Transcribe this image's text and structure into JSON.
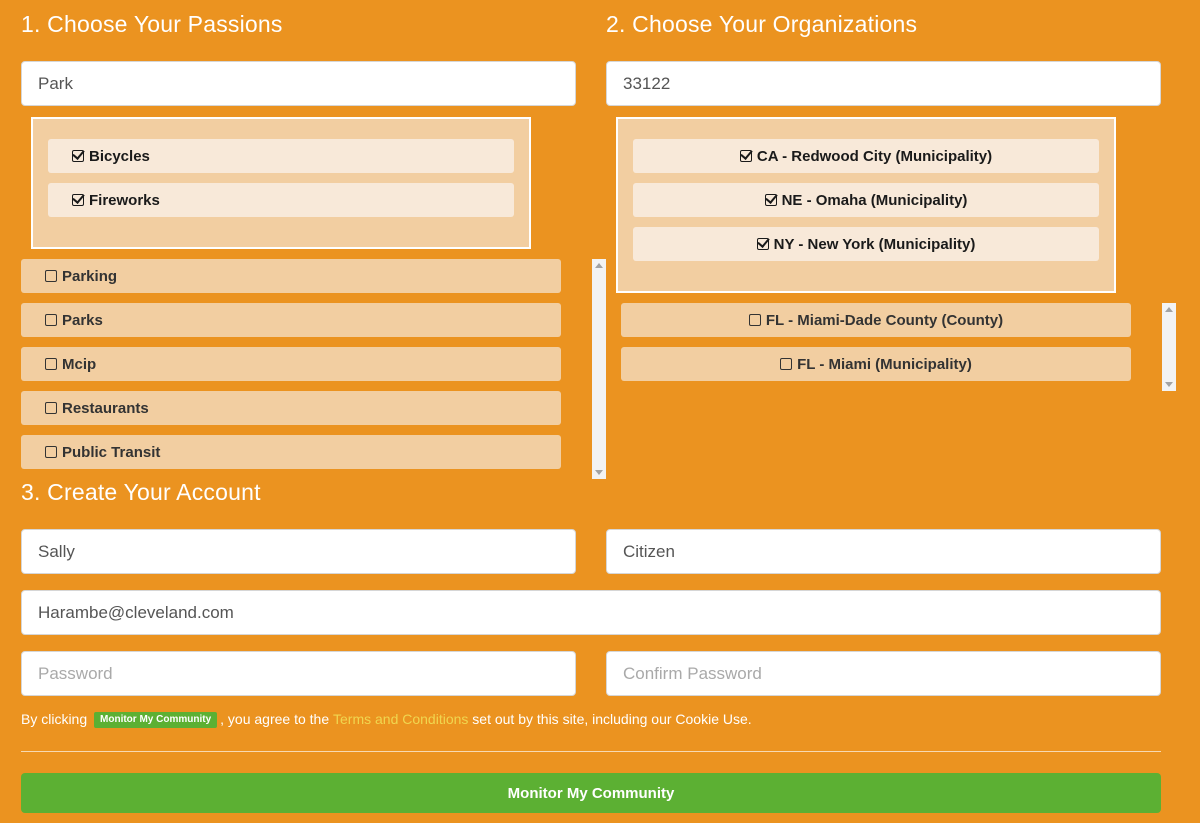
{
  "passions": {
    "title": "1. Choose Your Passions",
    "search_value": "Park",
    "selected": [
      "Bicycles",
      "Fireworks"
    ],
    "options": [
      "Parking",
      "Parks",
      "Mcip",
      "Restaurants",
      "Public Transit"
    ]
  },
  "organizations": {
    "title": "2. Choose Your Organizations",
    "search_value": "33122",
    "selected": [
      "CA - Redwood City (Municipality)",
      "NE - Omaha (Municipality)",
      "NY - New York (Municipality)"
    ],
    "options": [
      "FL - Miami-Dade County (County)",
      "FL - Miami (Municipality)"
    ]
  },
  "account": {
    "title": "3. Create Your Account",
    "first_name": "Sally",
    "last_name": "Citizen",
    "email": "Harambe@cleveland.com",
    "password_placeholder": "Password",
    "confirm_password_placeholder": "Confirm Password"
  },
  "terms": {
    "prefix": "By clicking",
    "badge": "Monitor My Community",
    "middle": ", you agree to the",
    "link": "Terms and Conditions",
    "suffix": "set out by this site, including our Cookie Use."
  },
  "submit_label": "Monitor My Community",
  "colors": {
    "background": "#eb9320",
    "chip_option": "#f2cea1",
    "chip_selected": "#f8e9d9",
    "button": "#5cb033",
    "link": "#f0d64f"
  },
  "icons": {
    "checked": "checkbox-checked-icon",
    "unchecked": "checkbox-empty-icon"
  }
}
